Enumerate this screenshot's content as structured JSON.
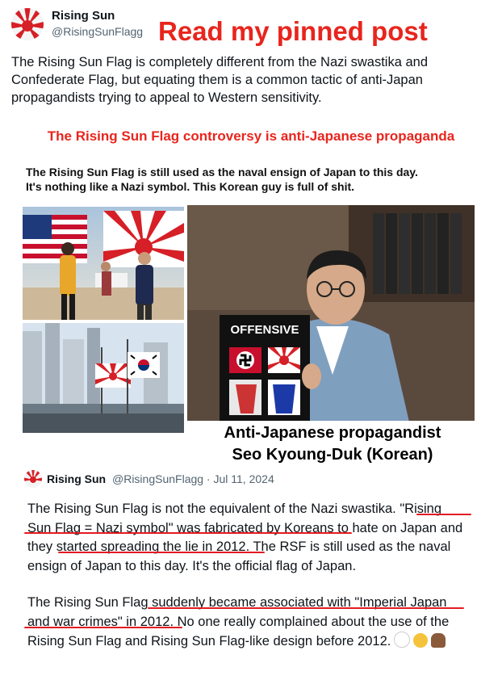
{
  "author": {
    "name": "Rising Sun",
    "handle": "@RisingSunFlagg"
  },
  "banner": "Read my pinned post",
  "tweet_text": "The Rising Sun Flag is completely different from the Nazi swastika and Confederate Flag, but equating them is a common tactic of anti-Japan propagandists trying to appeal to Western sensitivity.",
  "image": {
    "headline": "The Rising Sun Flag controversy is anti-Japanese propaganda",
    "caption_line1": "The Rising Sun Flag is still used as the naval ensign of Japan to this day.",
    "caption_line2": "It's nothing like a Nazi symbol. This Korean guy is full of shit.",
    "sign_text": "OFFENSIVE",
    "sub_caption_line1": "Anti-Japanese propagandist",
    "sub_caption_line2": "Seo Kyoung-Duk (Korean)"
  },
  "quote": {
    "name": "Rising Sun",
    "handle_date": "@RisingSunFlagg · Jul 11, 2024",
    "para1_lines": [
      "The Rising Sun Flag is not the equivalent of the Nazi swastika. \"Rising",
      "Sun Flag = Nazi symbol\" was fabricated by Koreans to hate on Japan and",
      "they started spreading the lie in 2012. The RSF is still used as the naval",
      "ensign of Japan to this day. It's the official flag of Japan."
    ],
    "para2_lines": [
      "The Rising Sun Flag suddenly became associated with \"Imperial Japan",
      "and war crimes\" in 2012. No one really  complained about the use of the",
      "Rising Sun Flag and Rising Sun Flag-like design before 2012."
    ]
  },
  "colors": {
    "accent_red": "#e8251d",
    "handle_gray": "#536471"
  }
}
